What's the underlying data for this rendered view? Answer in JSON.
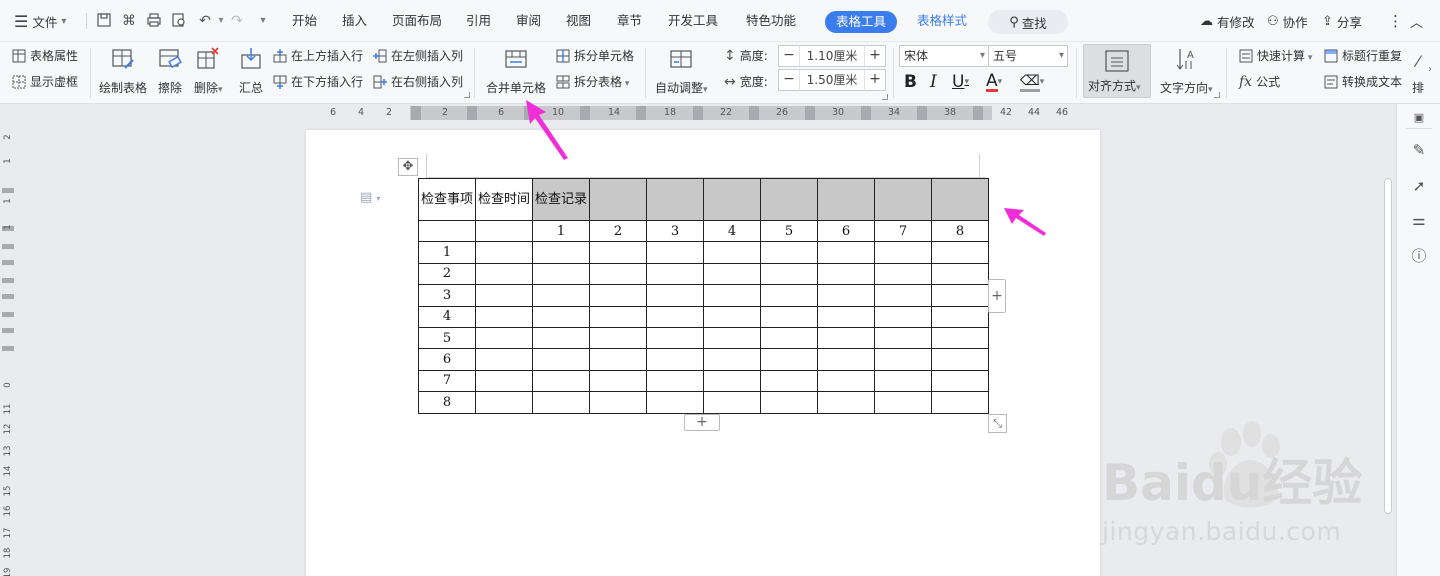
{
  "menubar": {
    "file_label": "文件",
    "tabs": [
      "开始",
      "插入",
      "页面布局",
      "引用",
      "审阅",
      "视图",
      "章节",
      "开发工具",
      "特色功能"
    ],
    "context_tabs": [
      "表格工具",
      "表格样式"
    ],
    "search_label": "查找",
    "right": {
      "has_changes": "有修改",
      "collaborate": "协作",
      "share": "分享"
    }
  },
  "ribbon": {
    "table_properties": "表格属性",
    "show_gridlines": "显示虚框",
    "draw_table": "绘制表格",
    "erase": "擦除",
    "delete": "删除",
    "summary": "汇总",
    "insert_above": "在上方插入行",
    "insert_below": "在下方插入行",
    "insert_left": "在左侧插入列",
    "insert_right": "在右侧插入列",
    "merge_cells": "合并单元格",
    "split_cells": "拆分单元格",
    "split_table": "拆分表格",
    "auto_fit": "自动调整",
    "height_label": "高度:",
    "height_value": "1.10厘米",
    "width_label": "宽度:",
    "width_value": "1.50厘米",
    "font_name": "宋体",
    "font_size": "五号",
    "align": "对齐方式",
    "text_direction": "文字方向",
    "quick_calc": "快速计算",
    "formula": "公式",
    "repeat_header": "标题行重复",
    "convert_text": "转换成文本",
    "sort": "排"
  },
  "ruler": {
    "ticks": [
      "6",
      "4",
      "2",
      "2",
      "6",
      "10",
      "14",
      "18",
      "22",
      "26",
      "30",
      "34",
      "38",
      "42",
      "44",
      "46"
    ],
    "vertical_ticks": [
      "2",
      "1",
      "1",
      "1",
      "0",
      "11",
      "12",
      "13",
      "14",
      "15",
      "16",
      "17",
      "18",
      "19"
    ]
  },
  "table": {
    "header": [
      "检查事项",
      "检查时间",
      "检查记录",
      "",
      "",
      "",
      "",
      "",
      "",
      ""
    ],
    "sub_header": [
      "",
      "",
      "1",
      "2",
      "3",
      "4",
      "5",
      "6",
      "7",
      "8"
    ],
    "row_labels": [
      "1",
      "2",
      "3",
      "4",
      "5",
      "6",
      "7",
      "8"
    ]
  },
  "table_controls": {
    "move_glyph": "✥",
    "add_glyph": "+",
    "resize_glyph": "⤡"
  },
  "watermark": {
    "brand": "Baidu经验",
    "url": "jingyan.baidu.com"
  },
  "colors": {
    "accent": "#3b7ded",
    "annotation": "#f02ed8",
    "shade": "#c8c8c8"
  }
}
